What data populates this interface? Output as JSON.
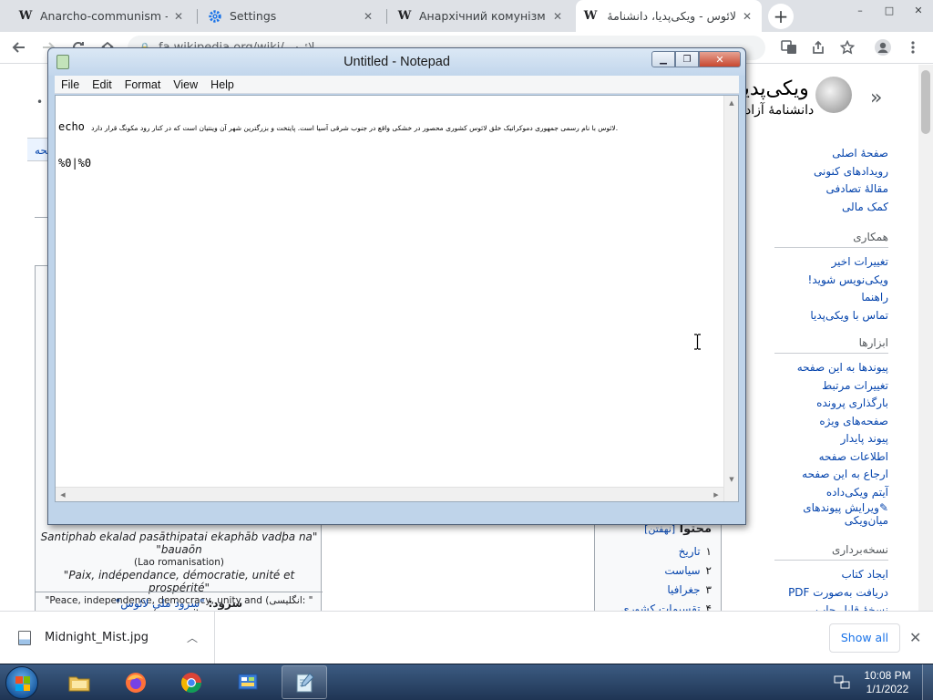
{
  "browser": {
    "tabs": [
      {
        "icon": "W",
        "title": "Anarcho-communism - Wi",
        "active": false
      },
      {
        "icon": "settings",
        "title": "Settings",
        "active": false
      },
      {
        "icon": "W",
        "title": "Анархічний комунізм — ",
        "active": false
      },
      {
        "icon": "W",
        "title": "لائوس - ویکی‌پدیا، دانشنامهٔ",
        "active": true
      }
    ],
    "new_tab": "+",
    "address": "fa.wikipedia.org/wiki/لائوس",
    "window_controls": {
      "minimize": "–",
      "maximize": "□",
      "close": "✕"
    }
  },
  "wiki": {
    "site_name": "ویکی‌پدیا",
    "tagline": "دانشنامهٔ آزاد",
    "nav_links": [
      "صفحهٔ اصلی",
      "رویدادهای کنونی",
      "مقالهٔ تصادفی",
      "کمک مالی"
    ],
    "contribute_heading": "همکاری",
    "contribute_links": [
      "تغییرات اخیر",
      "ویکی‌نویس شوید!",
      "راهنما",
      "تماس با ویکی‌پدیا"
    ],
    "tools_heading": "ابزارها",
    "tools_links": [
      "پیوندها به این صفحه",
      "تغییرات مرتبط",
      "بارگذاری پرونده",
      "صفحه‌های ویژه",
      "پیوند پایدار",
      "اطلاعات صفحه",
      "ارجاع به این صفحه",
      "آیتم ویکی‌داده"
    ],
    "edit_interlanguage": "ویرایش پیوندهای میان‌ویکی",
    "print_heading": "نسخه‌برداری",
    "print_links": [
      "ایجاد کتاب",
      "دریافت به‌صورت PDF",
      "نسخهٔ قابل چاپ"
    ],
    "left_fragment_tab": "صفحه",
    "infobox": {
      "motto_lao": "Santiphab ekalad pasāthipatai ekaphāb vadþa na\" \"bauaōn",
      "motto_lao_note": "(Lao romanisation)",
      "motto_fr": "\"Paix, indépendance, démocratie, unité et prospérité\"",
      "motto_en": "\"Peace, independence, democracy, unity and (انگلیسی: \"(prosperity",
      "anthem_label": "سرود:",
      "anthem_value": "\"سرود ملی لائوس\""
    },
    "toc": {
      "title": "محتوا",
      "toggle": "[نهفتن]",
      "items": [
        {
          "num": "۱",
          "label": "تاریخ"
        },
        {
          "num": "۲",
          "label": "سیاست"
        },
        {
          "num": "۳",
          "label": "جغرافیا"
        },
        {
          "num": "۴",
          "label": "تقسیمات کشوری"
        }
      ]
    }
  },
  "notepad": {
    "title": "Untitled - Notepad",
    "menu": [
      "File",
      "Edit",
      "Format",
      "View",
      "Help"
    ],
    "line1_cmd": "echo",
    "line1_text": "لائوس با نام رسمی جمهوری دموکراتیک خلق لائوس کشوری محصور در خشکی واقع در جنوب شرقی آسیا است. پایتخت و بزرگترین شهر آن وینتیان است که در کنار رود مکونگ قرار دارد.",
    "line2": "%0|%0"
  },
  "downloads": {
    "file_name": "Midnight_Mist.jpg",
    "show_all": "Show all"
  },
  "taskbar": {
    "apps": [
      "explorer",
      "firefox",
      "chrome",
      "control-panel",
      "notepad"
    ],
    "time": "10:08 PM",
    "date": "1/1/2022"
  }
}
